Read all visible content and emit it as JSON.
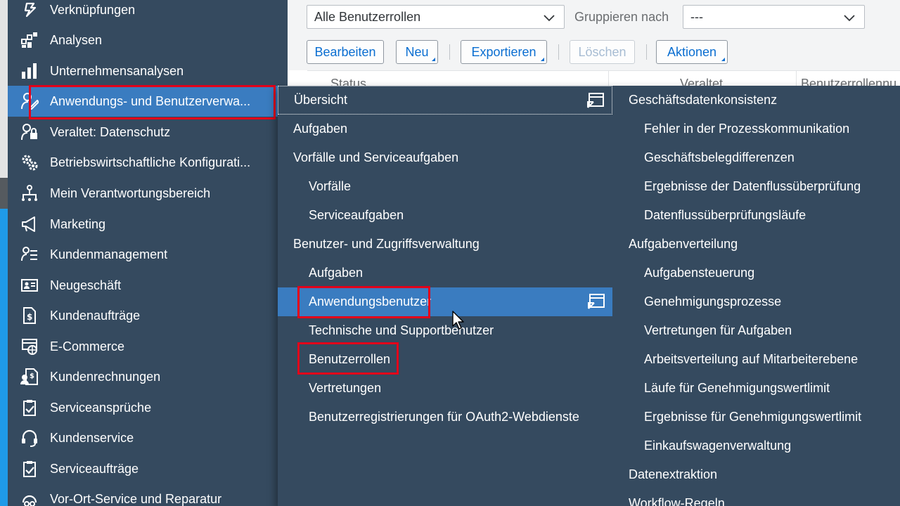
{
  "sidebar": {
    "items": [
      {
        "label": "Verknüpfungen",
        "icon": "link-icon"
      },
      {
        "label": "Analysen",
        "icon": "analytics-icon"
      },
      {
        "label": "Unternehmensanalysen",
        "icon": "bar-chart-icon"
      },
      {
        "label": "Anwendungs- und Benutzerverwa...",
        "icon": "user-edit-icon"
      },
      {
        "label": "Veraltet: Datenschutz",
        "icon": "user-lock-icon"
      },
      {
        "label": "Betriebswirtschaftliche Konfigurati...",
        "icon": "gears-icon"
      },
      {
        "label": "Mein Verantwortungsbereich",
        "icon": "org-chart-icon"
      },
      {
        "label": "Marketing",
        "icon": "megaphone-icon"
      },
      {
        "label": "Kundenmanagement",
        "icon": "customer-list-icon"
      },
      {
        "label": "Neugeschäft",
        "icon": "id-card-icon"
      },
      {
        "label": "Kundenaufträge",
        "icon": "sales-document-icon"
      },
      {
        "label": "E-Commerce",
        "icon": "web-shop-icon"
      },
      {
        "label": "Kundenrechnungen",
        "icon": "invoice-icon"
      },
      {
        "label": "Serviceansprüche",
        "icon": "clipboard-check-icon"
      },
      {
        "label": "Kundenservice",
        "icon": "headset-icon"
      },
      {
        "label": "Serviceaufträge",
        "icon": "clipboard-check-icon"
      },
      {
        "label": "Vor-Ort-Service und Reparatur",
        "icon": "repair-icon"
      }
    ]
  },
  "filter": {
    "role_select": "Alle Benutzerrollen",
    "group_label": "Gruppieren nach",
    "group_select": "---"
  },
  "toolbar": {
    "edit": "Bearbeiten",
    "new": "Neu",
    "export": "Exportieren",
    "delete": "Löschen",
    "actions": "Aktionen"
  },
  "table": {
    "columns": [
      "Status",
      "Veraltet",
      "Benutzerrollennu"
    ]
  },
  "flyout": {
    "col1": [
      {
        "label": "Übersicht",
        "level": 1
      },
      {
        "label": "Aufgaben",
        "level": 1
      },
      {
        "label": "Vorfälle und Serviceaufgaben",
        "level": 1
      },
      {
        "label": "Vorfälle",
        "level": 2
      },
      {
        "label": "Serviceaufgaben",
        "level": 2
      },
      {
        "label": "Benutzer- und Zugriffsverwaltung",
        "level": 1
      },
      {
        "label": "Aufgaben",
        "level": 2
      },
      {
        "label": "Anwendungsbenutzer",
        "level": 2
      },
      {
        "label": "Technische und Supportbenutzer",
        "level": 2
      },
      {
        "label": "Benutzerrollen",
        "level": 2
      },
      {
        "label": "Vertretungen",
        "level": 2
      },
      {
        "label": "Benutzerregistrierungen für OAuth2-Webdienste",
        "level": 2
      }
    ],
    "col2": [
      {
        "label": "Geschäftsdatenkonsistenz",
        "level": 1
      },
      {
        "label": "Fehler in der Prozesskommunikation",
        "level": 2
      },
      {
        "label": "Geschäftsbelegdifferenzen",
        "level": 2
      },
      {
        "label": "Ergebnisse der Datenflussüberprüfung",
        "level": 2
      },
      {
        "label": "Datenflussüberprüfungsläufe",
        "level": 2
      },
      {
        "label": "Aufgabenverteilung",
        "level": 1
      },
      {
        "label": "Aufgabensteuerung",
        "level": 2
      },
      {
        "label": "Genehmigungsprozesse",
        "level": 2
      },
      {
        "label": "Vertretungen für Aufgaben",
        "level": 2
      },
      {
        "label": "Arbeitsverteilung auf Mitarbeiterebene",
        "level": 2
      },
      {
        "label": "Läufe für Genehmigungswertlimit",
        "level": 2
      },
      {
        "label": "Ergebnisse für Genehmigungswertlimit",
        "level": 2
      },
      {
        "label": "Einkaufswagenverwaltung",
        "level": 2
      },
      {
        "label": "Datenextraktion",
        "level": 1
      },
      {
        "label": "Workflow-Regeln",
        "level": 1
      }
    ]
  },
  "colors": {
    "shell": "#354a5f",
    "selected": "#3a7cc0",
    "highlight_border": "#e2001a",
    "accent": "#0a6ed1"
  }
}
